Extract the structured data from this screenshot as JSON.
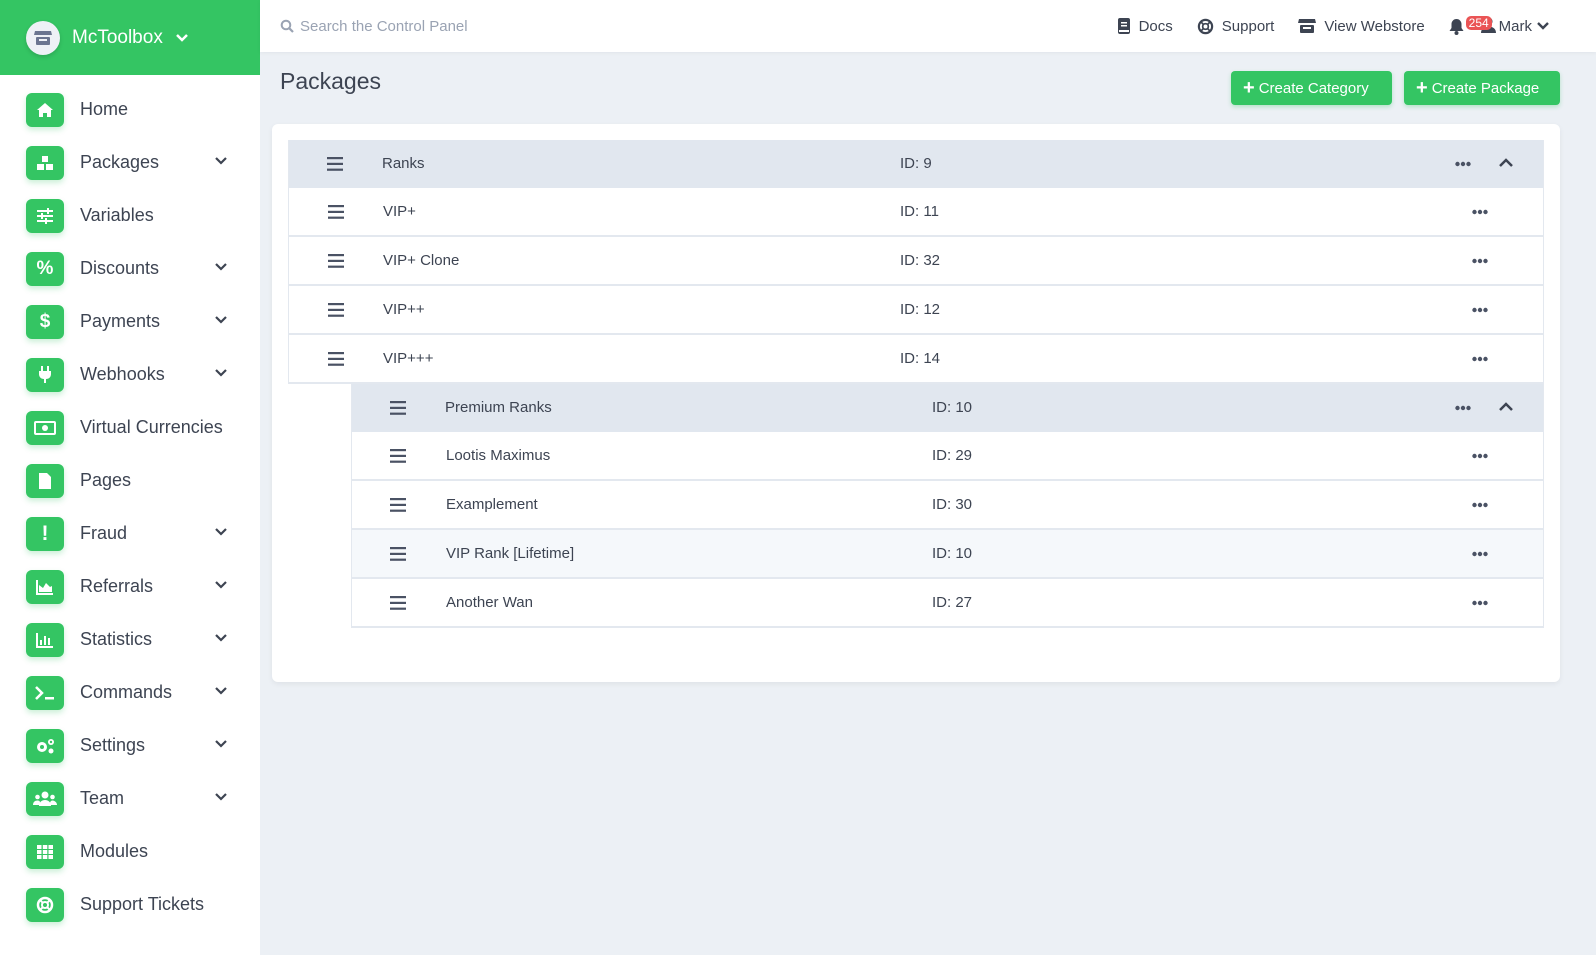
{
  "brand": {
    "name": "McToolbox",
    "icon": "store-icon"
  },
  "colors": {
    "accent": "#34c563",
    "badge": "#ea5455",
    "text": "#3d4452",
    "category_row": "#e1e7ef",
    "background": "#ecf0f5"
  },
  "sidebar": {
    "items": [
      {
        "label": "Home",
        "icon": "home-icon",
        "expandable": false
      },
      {
        "label": "Packages",
        "icon": "boxes-icon",
        "expandable": true
      },
      {
        "label": "Variables",
        "icon": "sliders-icon",
        "expandable": false
      },
      {
        "label": "Discounts",
        "icon": "percent-icon",
        "expandable": true
      },
      {
        "label": "Payments",
        "icon": "dollar-icon",
        "expandable": true
      },
      {
        "label": "Webhooks",
        "icon": "plug-icon",
        "expandable": true
      },
      {
        "label": "Virtual Currencies",
        "icon": "money-bill-icon",
        "expandable": false
      },
      {
        "label": "Pages",
        "icon": "file-icon",
        "expandable": false
      },
      {
        "label": "Fraud",
        "icon": "exclamation-icon",
        "expandable": true
      },
      {
        "label": "Referrals",
        "icon": "area-chart-icon",
        "expandable": true
      },
      {
        "label": "Statistics",
        "icon": "bar-chart-icon",
        "expandable": true
      },
      {
        "label": "Commands",
        "icon": "terminal-icon",
        "expandable": true
      },
      {
        "label": "Settings",
        "icon": "cogs-icon",
        "expandable": true
      },
      {
        "label": "Team",
        "icon": "users-icon",
        "expandable": true
      },
      {
        "label": "Modules",
        "icon": "grid-icon",
        "expandable": false
      },
      {
        "label": "Support Tickets",
        "icon": "lifering-icon",
        "expandable": false
      }
    ]
  },
  "topbar": {
    "search_placeholder": "Search the Control Panel",
    "links": [
      {
        "label": "Docs",
        "icon": "book-icon"
      },
      {
        "label": "Support",
        "icon": "lifering-icon"
      },
      {
        "label": "View Webstore",
        "icon": "store-icon"
      }
    ],
    "notifications_count": "254",
    "user_name": "Mark"
  },
  "page": {
    "title": "Packages",
    "create_category_label": "Create Category",
    "create_package_label": "Create Package"
  },
  "categories": [
    {
      "name": "Ranks",
      "id": "ID: 9",
      "expanded": true,
      "packages": [
        {
          "name": "VIP+",
          "id": "ID: 11"
        },
        {
          "name": "VIP+ Clone",
          "id": "ID: 32"
        },
        {
          "name": "VIP++",
          "id": "ID: 12"
        },
        {
          "name": "VIP+++",
          "id": "ID: 14"
        }
      ],
      "subcategories": [
        {
          "name": "Premium Ranks",
          "id": "ID: 10",
          "expanded": true,
          "packages": [
            {
              "name": "Lootis Maximus",
              "id": "ID: 29"
            },
            {
              "name": "Examplement",
              "id": "ID: 30"
            },
            {
              "name": "VIP Rank [Lifetime]",
              "id": "ID: 10"
            },
            {
              "name": "Another Wan",
              "id": "ID: 27"
            }
          ]
        }
      ]
    }
  ]
}
